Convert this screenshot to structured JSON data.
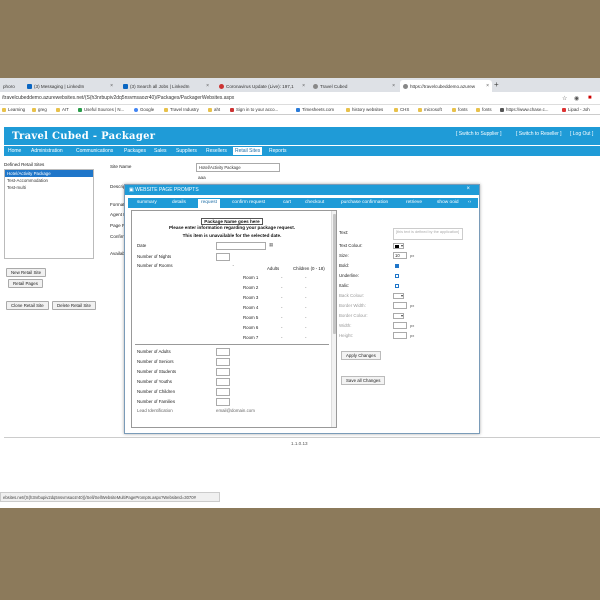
{
  "browser": {
    "tabs": [
      {
        "label": "phoro",
        "icon": "flag-icon",
        "color": "#c44"
      },
      {
        "label": "(3) Messaging | LinkedIn",
        "icon": "linkedin-icon",
        "color": "#0a66c2"
      },
      {
        "label": "(3) Search all Jobs | LinkedIn",
        "icon": "linkedin-icon",
        "color": "#0a66c2"
      },
      {
        "label": "Coronavirus Update (Live): 197,1",
        "icon": "globe-icon",
        "color": "#c33"
      },
      {
        "label": "Travel Cubed",
        "icon": "globe-icon",
        "color": "#888"
      },
      {
        "label": "https://travelcubeddemo.azurew",
        "icon": "globe-icon",
        "color": "#888"
      }
    ],
    "new_tab": "+",
    "url": "/travelcubeddemo.azurewebsites.net/(S(h3nrbupiv2dq5nsvmsaozr40)/Packages/PackagerWebsites.aspx",
    "bookmarks": [
      "Learning",
      "greg",
      "AIT",
      "Useful Sources | N...",
      "Google",
      "Travel Industry",
      "aht",
      "Sign in to your acco...",
      "Timesheets.com",
      "history websites",
      "CHS",
      "microsoft",
      "fonts",
      "fonts",
      "https://www.chase.c...",
      "Lipad - Joh"
    ],
    "status_url": "ebsites.net/(S(h3nrbupiv2dq5nsvmsaozr40))/Sell/SellWebsiteMultiPagePrompts.aspx?WebsiteId=3070#"
  },
  "app": {
    "title": "Travel Cubed - Packager",
    "header_links": [
      "[ Switch to Supplier ]",
      "[ Switch to Reseller ]",
      "[ Log Out ]"
    ],
    "nav": [
      "Home",
      "Administration",
      "Communications",
      "Packages",
      "Sales",
      "Suppliers",
      "Resellers",
      "Retail Sites",
      "Reports"
    ],
    "nav_active": "Retail Sites",
    "sidebar": {
      "label": "Defined Retail Sites",
      "items": [
        "Hotel/Activity Package",
        "Test-Accommodation",
        "Test-multi"
      ],
      "selected": "Hotel/Activity Package",
      "buttons": [
        "New Retail Site",
        "Retail Pages",
        "Clone Retail Site",
        "Delete Retail Site"
      ]
    },
    "form": {
      "labels": [
        "Site Name",
        "Descrip",
        "Format",
        "Agent P",
        "Page P",
        "Confirm",
        "Availab"
      ],
      "site_name": "Hotel/Activity Package",
      "site_value": "aaa"
    },
    "version": "1.1.0.13"
  },
  "modal": {
    "title": "WEBSITE PAGE PROMPTS",
    "close": "×",
    "tabs": [
      "summary",
      "details",
      "request",
      "confirm request",
      "cart",
      "checkout",
      "purchase confirmation",
      "retrieve",
      "show ooid"
    ],
    "active_tab": "request",
    "preview": {
      "package_name": "Package Name goes here",
      "message1": "Please enter information regarding your package request.",
      "message2": "This item is unavailable for the selected date.",
      "date_label": "Date",
      "nights_label": "Number of Nights",
      "nights_value": "",
      "rooms_label": "Number of Rooms",
      "rooms_value": "-",
      "adults_header": "Adults",
      "children_header": "Children (0 - 18)",
      "rooms": [
        "Room 1",
        "Room 2",
        "Room 3",
        "Room 4",
        "Room 5",
        "Room 6",
        "Room 7"
      ],
      "dash": "-",
      "counts": [
        "Number of Adults",
        "Number of Seniors",
        "Number of Students",
        "Number of Youths",
        "Number of Children",
        "Number of Families"
      ],
      "cutoff_label": "Lead Identification",
      "cutoff_value": "email@domain.com"
    },
    "style": {
      "text_label": "Text:",
      "text_placeholder": "[this text is defined by the application]",
      "text_colour_label": "Text Colour:",
      "text_colour": "#000000",
      "size_label": "Size:",
      "size_value": "10",
      "px": "px",
      "bold_label": "Bold:",
      "underline_label": "Underline:",
      "italic_label": "Italic:",
      "back_colour_label": "Back Colour:",
      "border_width_label": "Border Width:",
      "border_colour_label": "Border Colour:",
      "width_label": "Width:",
      "height_label": "Height:",
      "apply_button": "Apply Changes",
      "save_button": "Save all Changes"
    }
  }
}
